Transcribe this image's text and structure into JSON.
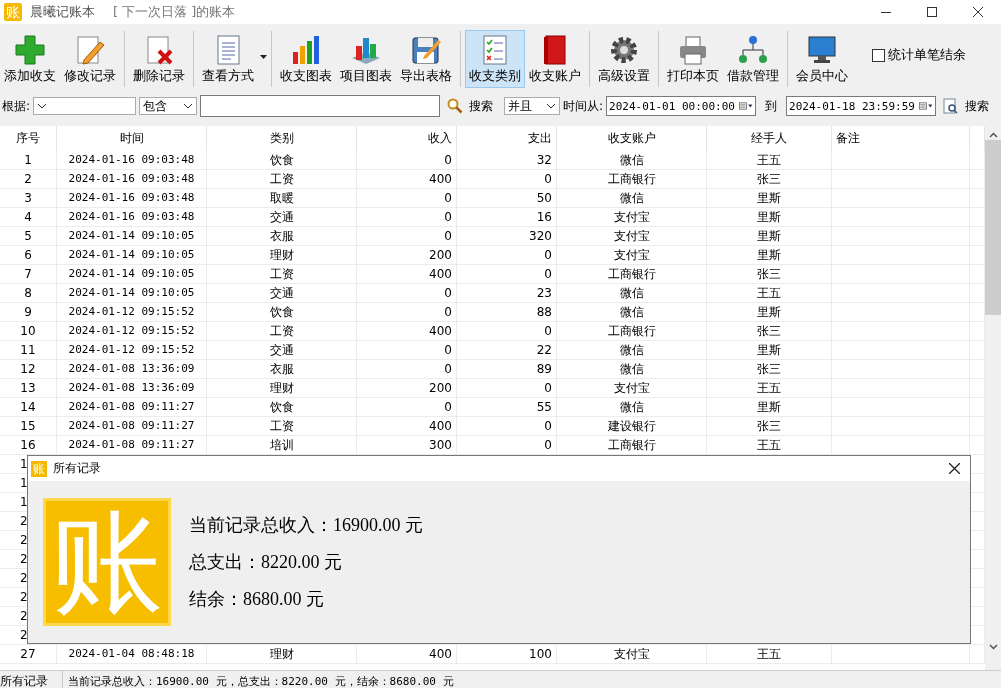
{
  "window": {
    "icon_text": "账",
    "title": "晨曦记账本",
    "subtitle": "[ 下一次日落 ]的账本"
  },
  "toolbar": {
    "groups": [
      [
        {
          "label": "添加收支",
          "selected": false
        },
        {
          "label": "修改记录",
          "selected": false
        }
      ],
      [
        {
          "label": "删除记录",
          "selected": false
        }
      ],
      [
        {
          "label": "查看方式",
          "selected": false,
          "kind": "dropdown"
        }
      ],
      [
        {
          "label": "收支图表",
          "selected": false
        },
        {
          "label": "项目图表",
          "selected": false
        },
        {
          "label": "导出表格",
          "selected": false
        }
      ],
      [
        {
          "label": "收支类别",
          "selected": true
        },
        {
          "label": "收支账户",
          "selected": false
        }
      ],
      [
        {
          "label": "高级设置",
          "selected": false
        }
      ],
      [
        {
          "label": "打印本页",
          "selected": false
        },
        {
          "label": "借款管理",
          "selected": false
        }
      ],
      [
        {
          "label": "会员中心",
          "selected": false
        }
      ]
    ],
    "checkbox": {
      "label": "统计单笔结余",
      "checked": false
    }
  },
  "filter": {
    "basis_label": "根据:",
    "match_value": "包含",
    "search_button": "搜索",
    "logic_value": "并且",
    "from_label": "时间从:",
    "from_value": "2024-01-01 00:00:00",
    "to_label": "到",
    "to_value": "2024-01-18 23:59:59",
    "search_button_2": "搜索"
  },
  "table": {
    "columns": [
      "序号",
      "时间",
      "类别",
      "收入",
      "支出",
      "收支账户",
      "经手人",
      "备注"
    ],
    "rows": [
      {
        "cells": [
          "1",
          "2024-01-16 09:03:48",
          "饮食",
          "0",
          "32",
          "微信",
          "王五"
        ]
      },
      {
        "cells": [
          "2",
          "2024-01-16 09:03:48",
          "工资",
          "400",
          "0",
          "工商银行",
          "张三"
        ]
      },
      {
        "cells": [
          "3",
          "2024-01-16 09:03:48",
          "取暖",
          "0",
          "50",
          "微信",
          "里斯"
        ]
      },
      {
        "cells": [
          "4",
          "2024-01-16 09:03:48",
          "交通",
          "0",
          "16",
          "支付宝",
          "里斯"
        ]
      },
      {
        "cells": [
          "5",
          "2024-01-14 09:10:05",
          "衣服",
          "0",
          "320",
          "支付宝",
          "里斯"
        ]
      },
      {
        "cells": [
          "6",
          "2024-01-14 09:10:05",
          "理财",
          "200",
          "0",
          "支付宝",
          "里斯"
        ]
      },
      {
        "cells": [
          "7",
          "2024-01-14 09:10:05",
          "工资",
          "400",
          "0",
          "工商银行",
          "张三"
        ]
      },
      {
        "cells": [
          "8",
          "2024-01-14 09:10:05",
          "交通",
          "0",
          "23",
          "微信",
          "王五"
        ]
      },
      {
        "cells": [
          "9",
          "2024-01-12 09:15:52",
          "饮食",
          "0",
          "88",
          "微信",
          "里斯"
        ]
      },
      {
        "cells": [
          "10",
          "2024-01-12 09:15:52",
          "工资",
          "400",
          "0",
          "工商银行",
          "张三"
        ]
      },
      {
        "cells": [
          "11",
          "2024-01-12 09:15:52",
          "交通",
          "0",
          "22",
          "微信",
          "里斯"
        ]
      },
      {
        "cells": [
          "12",
          "2024-01-08 13:36:09",
          "衣服",
          "0",
          "89",
          "微信",
          "张三"
        ]
      },
      {
        "cells": [
          "13",
          "2024-01-08 13:36:09",
          "理财",
          "200",
          "0",
          "支付宝",
          "王五"
        ]
      },
      {
        "cells": [
          "14",
          "2024-01-08 09:11:27",
          "饮食",
          "0",
          "55",
          "微信",
          "里斯"
        ]
      },
      {
        "cells": [
          "15",
          "2024-01-08 09:11:27",
          "工资",
          "400",
          "0",
          "建设银行",
          "张三"
        ]
      },
      {
        "cells": [
          "16",
          "2024-01-08 09:11:27",
          "培训",
          "300",
          "0",
          "工商银行",
          "王五"
        ]
      },
      {
        "kind": "covered",
        "cells": [
          "1"
        ]
      },
      {
        "kind": "covered",
        "cells": [
          "1"
        ]
      },
      {
        "kind": "covered",
        "cells": [
          "1"
        ]
      },
      {
        "kind": "covered",
        "cells": [
          "2"
        ]
      },
      {
        "kind": "covered",
        "cells": [
          "2"
        ]
      },
      {
        "kind": "covered",
        "cells": [
          "2"
        ]
      },
      {
        "kind": "covered",
        "cells": [
          "2"
        ]
      },
      {
        "kind": "covered",
        "cells": [
          "2"
        ]
      },
      {
        "kind": "covered",
        "cells": [
          "2"
        ]
      },
      {
        "kind": "covered",
        "cells": [
          "2"
        ]
      },
      {
        "cells": [
          "27",
          "2024-01-04 08:48:18",
          "理财",
          "400",
          "100",
          "支付宝",
          "王五"
        ]
      }
    ]
  },
  "dialog": {
    "icon_text": "账",
    "title": "所有记录",
    "logo_text": "账",
    "lines": [
      "当前记录总收入：16900.00 元",
      "总支出：8220.00 元",
      "结余：8680.00 元"
    ]
  },
  "status_bar": {
    "left": "所有记录",
    "right": "当前记录总收入：16900.00 元，总支出：8220.00 元，结余：8680.00 元"
  }
}
